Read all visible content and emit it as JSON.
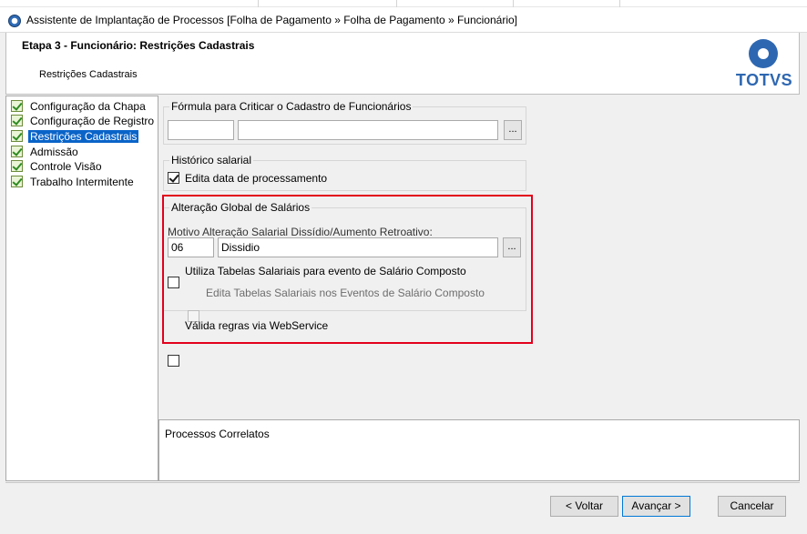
{
  "window": {
    "title": "Assistente de Implantação de Processos [Folha de Pagamento » Folha de Pagamento » Funcionário]"
  },
  "header": {
    "step_title": "Etapa 3 - Funcionário: Restrições Cadastrais",
    "step_subtitle": "Restrições Cadastrais",
    "logo_text": "TOTVS"
  },
  "tree": {
    "items": [
      {
        "label": "Configuração da Chapa",
        "selected": false
      },
      {
        "label": "Configuração de Registro",
        "selected": false
      },
      {
        "label": "Restrições Cadastrais",
        "selected": true
      },
      {
        "label": "Admissão",
        "selected": false
      },
      {
        "label": "Controle Visão",
        "selected": false
      },
      {
        "label": "Trabalho Intermitente",
        "selected": false
      }
    ]
  },
  "formula_group": {
    "title": "Fórmula para Criticar o Cadastro de Funcionários",
    "code_value": "",
    "description_value": "",
    "lookup_label": "..."
  },
  "historico_group": {
    "title": "Histórico salarial",
    "edit_date_label": "Edita data de processamento",
    "edit_date_checked": true
  },
  "alteracao_group": {
    "title": "Alteração Global de Salários",
    "motivo_label": "Motivo Alteração Salarial Dissídio/Aumento Retroativo:",
    "motivo_code": "06",
    "motivo_description": "Dissidio",
    "lookup_label": "...",
    "utiliza_tabelas_label": "Utiliza Tabelas Salariais para evento de Salário Composto",
    "utiliza_tabelas_checked": false,
    "edita_tabelas_label": "Edita Tabelas Salariais nos Eventos de Salário Composto",
    "edita_tabelas_checked": false,
    "valida_regras_label": "Válida regras via WebService",
    "valida_regras_checked": false
  },
  "correlatos": {
    "label": "Processos Correlatos"
  },
  "footer": {
    "back_label": "< Voltar",
    "next_label": "Avançar >",
    "cancel_label": "Cancelar"
  },
  "colors": {
    "selection": "#0a64c8",
    "highlight_border": "#e3001b",
    "brand": "#2e67b1"
  }
}
